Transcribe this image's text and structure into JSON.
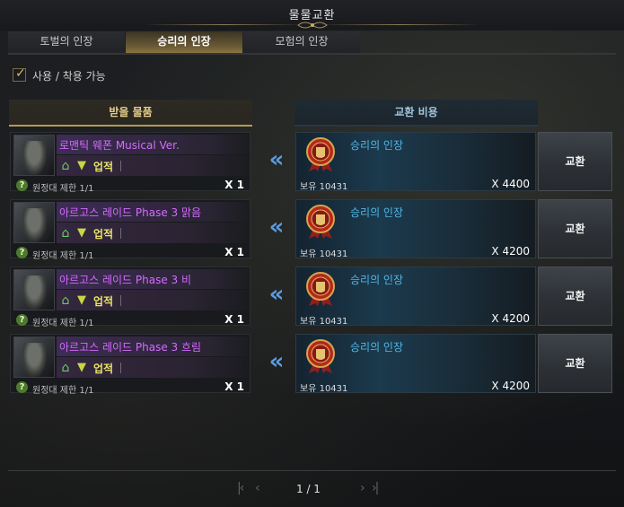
{
  "window": {
    "title": "물물교환"
  },
  "tabs": [
    {
      "label": "토벌의 인장",
      "active": false
    },
    {
      "label": "승리의 인장",
      "active": true
    },
    {
      "label": "모험의 인장",
      "active": false
    }
  ],
  "filter": {
    "label": "사용 / 착용 가능",
    "checked": true
  },
  "headers": {
    "receive": "받을 물품",
    "cost": "교환 비용"
  },
  "rows": [
    {
      "item_name": "로맨틱 웨폰 Musical Ver.",
      "tag": "업적",
      "limit": "원정대 제한 1/1",
      "qty": "X 1",
      "cost_name": "승리의 인장",
      "owned": "보유 10431",
      "cost_qty": "X 4400",
      "button": "교환"
    },
    {
      "item_name": "아르고스 레이드 Phase 3 맑음",
      "tag": "업적",
      "limit": "원정대 제한 1/1",
      "qty": "X 1",
      "cost_name": "승리의 인장",
      "owned": "보유 10431",
      "cost_qty": "X 4200",
      "button": "교환"
    },
    {
      "item_name": "아르고스 레이드 Phase 3 비",
      "tag": "업적",
      "limit": "원정대 제한 1/1",
      "qty": "X 1",
      "cost_name": "승리의 인장",
      "owned": "보유 10431",
      "cost_qty": "X 4200",
      "button": "교환"
    },
    {
      "item_name": "아르고스 레이드 Phase 3 흐림",
      "tag": "업적",
      "limit": "원정대 제한 1/1",
      "qty": "X 1",
      "cost_name": "승리의 인장",
      "owned": "보유 10431",
      "cost_qty": "X 4200",
      "button": "교환"
    }
  ],
  "pager": {
    "text": "1 / 1"
  },
  "colors": {
    "accent_gold": "#d8b865",
    "item_name_purple": "#d56bff",
    "cost_name_blue": "#52b7e8",
    "arrow_blue": "#5c9be0"
  },
  "icons": {
    "exchange_arrow": "double-chevron-left-icon",
    "medal": "seal-medal-icon",
    "pager_first": "page-first-icon",
    "pager_prev": "page-prev-icon",
    "pager_next": "page-next-icon",
    "pager_last": "page-last-icon"
  }
}
